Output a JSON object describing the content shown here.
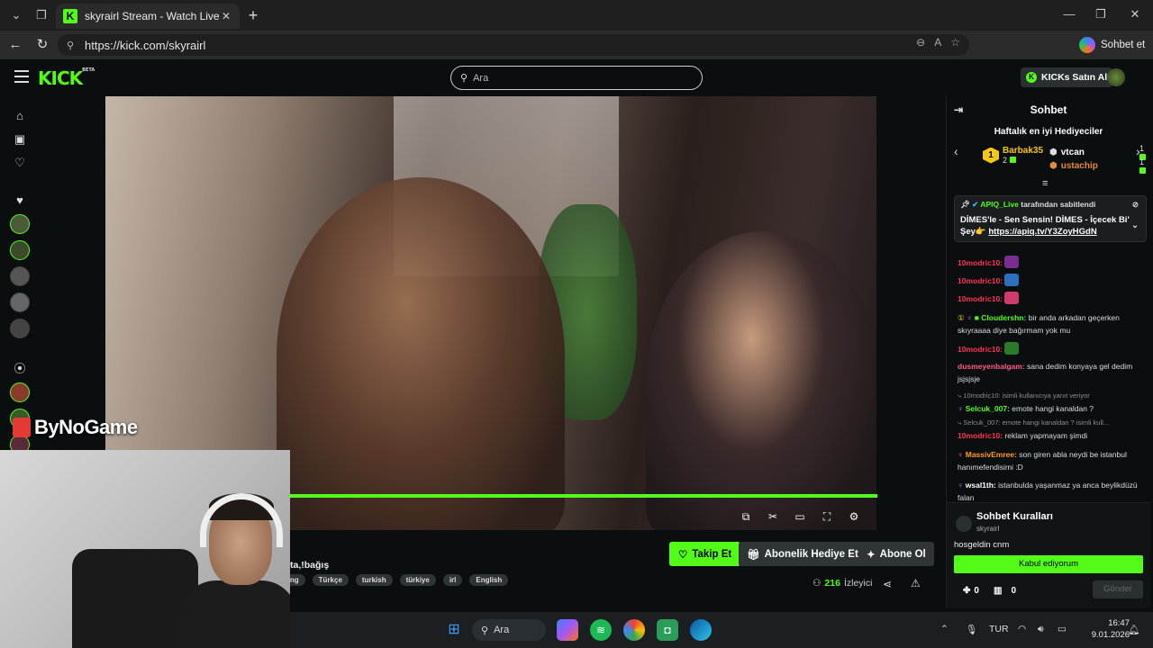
{
  "browser": {
    "tab_title": "skyrairl Stream - Watch Live on Kic",
    "tab_favicon": "K",
    "url": "https://kick.com/skyrairl",
    "copilot_label": "Sohbet et"
  },
  "header": {
    "logo": "KICK",
    "logo_badge": "BETA",
    "search_placeholder": "Ara",
    "kicks_button": "KICKs Satın Al"
  },
  "overlay": {
    "brand": "ByNoGame"
  },
  "stream": {
    "title_partial": "ta,!bağış",
    "tags": [
      "ting",
      "Türkçe",
      "turkish",
      "türkiye",
      "irl",
      "English"
    ],
    "follow_label": "Takip Et",
    "gift_sub_label": "Abonelik Hediye Et",
    "subscribe_label": "Abone Ol",
    "viewers_count": "216",
    "viewers_label": "İzleyici"
  },
  "chat": {
    "title": "Sohbet",
    "gifters_title": "Haftalık en iyi Hediyeciler",
    "gifters": [
      {
        "rank": "1",
        "name": "Barbak35",
        "count": "2"
      },
      {
        "name": "vtcan",
        "count": "1"
      },
      {
        "name": "ustachip",
        "count": "1"
      }
    ],
    "pinned": {
      "by_user": "APIQ_Live",
      "by_suffix": "tarafından sabitlendi",
      "text": "DİMES'le - Sen Sensin! DİMES - İçecek Bi' Şey👉",
      "link": "https://apiq.tv/Y3ZoyHGdN"
    },
    "messages": [
      {
        "user": "10modric10:",
        "text": ""
      },
      {
        "user": "10modric10:",
        "text": ""
      },
      {
        "user": "10modric10:",
        "text": ""
      },
      {
        "user": "Cloudershn:",
        "text": "bir anda arkadan geçerken skıyraaaa diye bağırmam yok mu"
      },
      {
        "user": "10modric10:",
        "text": ""
      },
      {
        "user": "dusmeyenbalgam:",
        "text": "sana dedim konyaya gel dedim jsjsjsje"
      },
      {
        "reply": "10modric10: isimli kullanıcıya yanıt veriyor",
        "user": "Selcuk_007:",
        "text": "emote hangi kanaldan ?"
      },
      {
        "reply": "Selcuk_007: emote hangi kanaldan ? isimli kull...",
        "user": "10modric10:",
        "text": "reklam yapmayam şimdi"
      },
      {
        "user": "MassivEmree:",
        "text": "son giren abla neydi be istanbul hanımefendisimi :D"
      },
      {
        "user": "wsal1th:",
        "text": "istanbulda yaşanmaz ya anca beylikdüzü falan"
      }
    ],
    "rules": {
      "title": "Sohbet Kuralları",
      "channel": "skyrairl",
      "body": "hosgeldin cnm",
      "accept_label": "Kabul ediyorum",
      "points": "0",
      "gifts": "0",
      "send_label": "Gönder"
    }
  },
  "taskbar": {
    "search_label": "Ara",
    "language": "TUR",
    "time": "16:47",
    "date": "9.01.2026"
  },
  "colors": {
    "kick_green": "#53fc18",
    "background": "#0b0e0f",
    "gold": "#f5c518"
  }
}
